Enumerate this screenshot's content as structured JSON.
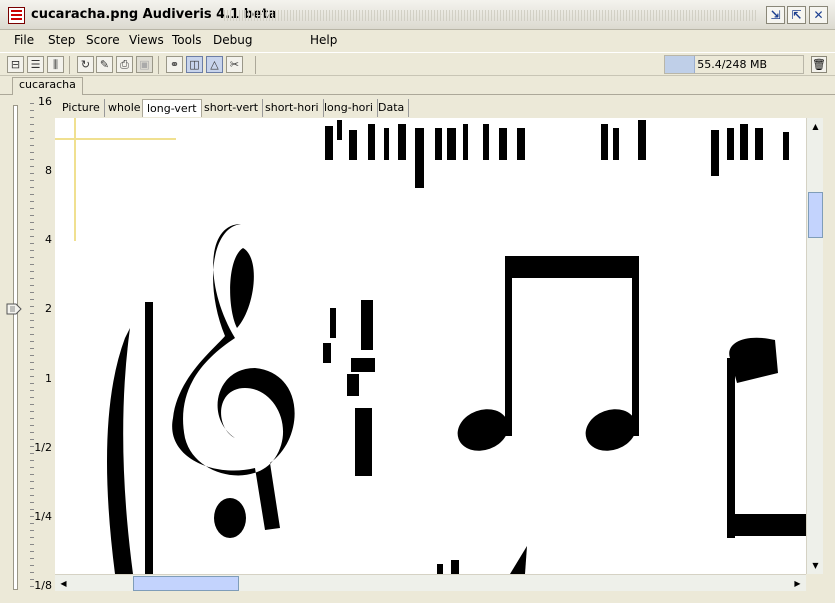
{
  "window": {
    "title": "cucaracha.png Audiveris 4.1 beta",
    "icon": "audiveris-app-icon"
  },
  "menu": {
    "file": "File",
    "step": "Step",
    "score": "Score",
    "views": "Views",
    "tools": "Tools",
    "debug": "Debug",
    "help": "Help"
  },
  "toolbar": {
    "memory_text": "55.4/248 MB",
    "memory_used_fraction": 0.22
  },
  "score_tab": "cucaracha",
  "view_tabs": [
    "Picture",
    "whole",
    "long-vert",
    "short-vert",
    "short-hori",
    "long-hori",
    "Data"
  ],
  "active_view_tab": "long-vert",
  "zoom_ruler": {
    "labels": [
      "16",
      "8",
      "4",
      "2",
      "1",
      "1/2",
      "1/4",
      "1/8"
    ],
    "current": "2"
  },
  "colors": {
    "selection_accent": "#f0e090",
    "scroll_thumb": "#c3d3fd"
  }
}
